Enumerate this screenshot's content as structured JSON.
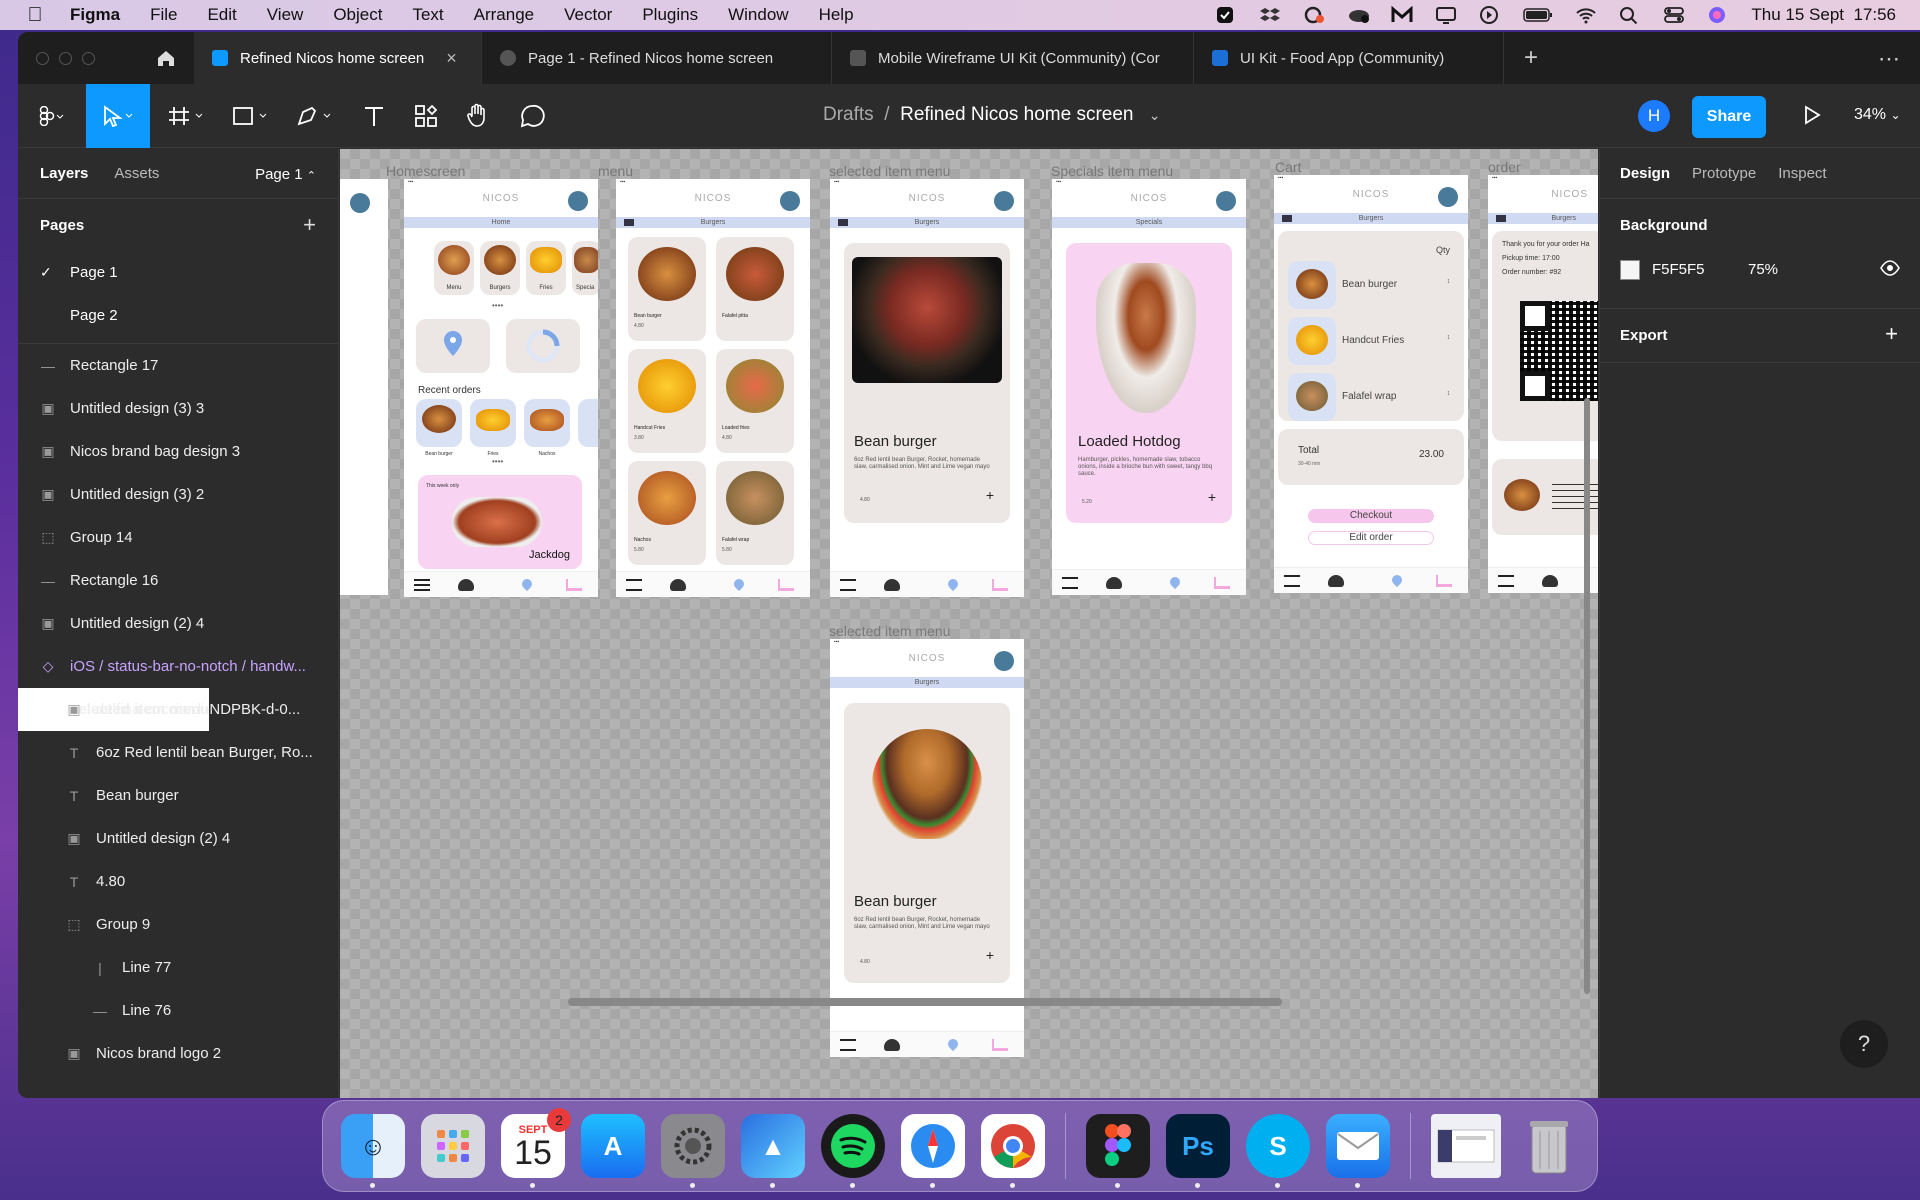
{
  "menubar": {
    "app": "Figma",
    "items": [
      "File",
      "Edit",
      "View",
      "Object",
      "Text",
      "Arrange",
      "Vector",
      "Plugins",
      "Window",
      "Help"
    ],
    "clock": "Thu 15 Sept  17:56"
  },
  "tabs": [
    {
      "label": "Refined Nicos home screen"
    },
    {
      "label": "Page 1 - Refined Nicos home screen"
    },
    {
      "label": "Mobile Wireframe UI Kit (Community) (Cor"
    },
    {
      "label": "UI Kit - Food App (Community)"
    }
  ],
  "toolbar": {
    "crumb_root": "Drafts",
    "crumb_sep": "/",
    "file_name": "Refined Nicos home screen",
    "avatar_initial": "H",
    "share_label": "Share",
    "zoom": "34%"
  },
  "left_panel": {
    "tab_layers": "Layers",
    "tab_assets": "Assets",
    "page_selector": "Page 1",
    "pages_heading": "Pages",
    "pages": [
      "Page 1",
      "Page 2"
    ],
    "layers": [
      {
        "label": "Rectangle 17",
        "kind": "rect",
        "indent": 0
      },
      {
        "label": "Untitled design (3) 3",
        "kind": "image",
        "indent": 0
      },
      {
        "label": "Nicos brand bag design 3",
        "kind": "image",
        "indent": 0
      },
      {
        "label": "Untitled design (3) 2",
        "kind": "image",
        "indent": 0
      },
      {
        "label": "Group 14",
        "kind": "group",
        "indent": 0
      },
      {
        "label": "Rectangle 16",
        "kind": "rect",
        "indent": 0
      },
      {
        "label": "Untitled design (2) 4",
        "kind": "image",
        "indent": 0
      },
      {
        "label": "iOS / status-bar-no-notch / handw...",
        "kind": "component",
        "indent": 0
      },
      {
        "label": "selected item menu",
        "kind": "frame",
        "indent": 0
      },
      {
        "label": "delfina-cocciardi-NDPBK-d-0...",
        "kind": "image",
        "indent": 1
      },
      {
        "label": "6oz Red lentil bean Burger, Ro...",
        "kind": "text",
        "indent": 1
      },
      {
        "label": "Bean burger",
        "kind": "text",
        "indent": 1
      },
      {
        "label": "Untitled design (2) 4",
        "kind": "image",
        "indent": 1
      },
      {
        "label": "4.80",
        "kind": "text",
        "indent": 1
      },
      {
        "label": "Group 9",
        "kind": "group",
        "indent": 1
      },
      {
        "label": "Line 77",
        "kind": "vline",
        "indent": 2
      },
      {
        "label": "Line 76",
        "kind": "line",
        "indent": 2
      },
      {
        "label": "Nicos brand logo 2",
        "kind": "image",
        "indent": 1
      }
    ]
  },
  "canvas": {
    "frame_labels": [
      "Homescreen",
      "menu",
      "selected item menu",
      "Specials item menu",
      "Cart",
      "order confirmation",
      "selected item menu"
    ],
    "brand": "NICOS",
    "home": {
      "nav": "Home",
      "cats": [
        "Menu",
        "Burgers",
        "Fries",
        "Specia"
      ],
      "recent_heading": "Recent orders",
      "recent": [
        "Bean burger",
        "Fries",
        "Nachos"
      ],
      "promo_tag": "This week only",
      "promo_name": "Jackdog"
    },
    "menu": {
      "nav": "Burgers",
      "items": [
        {
          "name": "Bean burger",
          "price": "4.80"
        },
        {
          "name": "Falafel pitta",
          "price": ""
        },
        {
          "name": "Handcut Fries",
          "price": "3.80"
        },
        {
          "name": "Loaded fries",
          "price": "4.80"
        },
        {
          "name": "Nachos",
          "price": "5.80"
        },
        {
          "name": "Falafel wrap",
          "price": "5.80"
        }
      ]
    },
    "selected": {
      "nav": "Burgers",
      "title": "Bean burger",
      "desc": "6oz Red lentil bean Burger, Rocket, homemade slaw, carmalised onion, Mint and Lime vegan mayo",
      "price": "4.80"
    },
    "specials": {
      "nav": "Specials",
      "title": "Loaded Hotdog",
      "desc": "Hamburger, pickles, homemade slaw, tobacco onions, inside a brioche bun with sweet, tangy bbq sauce.",
      "price": "5.20"
    },
    "cart": {
      "nav": "Burgers",
      "qty_heading": "Qty",
      "items": [
        {
          "name": "Bean burger",
          "qty": "1"
        },
        {
          "name": "Handcut Fries",
          "qty": "1"
        },
        {
          "name": "Falafel wrap",
          "qty": "1"
        }
      ],
      "total_label": "Total",
      "total_sub": "30-40 min",
      "total_value": "23.00",
      "checkout": "Checkout",
      "edit": "Edit order"
    },
    "confirm": {
      "nav": "Burgers",
      "line1": "Thank you for your order Ha",
      "line2": "Pickup time: 17:00",
      "line3": "Order number: #92"
    }
  },
  "right_panel": {
    "tabs": [
      "Design",
      "Prototype",
      "Inspect"
    ],
    "background_heading": "Background",
    "bg_hex": "F5F5F5",
    "bg_opacity": "75%",
    "export_heading": "Export",
    "help": "?"
  },
  "dock": {
    "calendar_month": "SEPT",
    "calendar_day": "15",
    "calendar_badge": "2",
    "apps": [
      "finder-icon",
      "launchpad-icon",
      "calendar-icon",
      "app-store-icon",
      "system-settings-icon",
      "affinity-icon",
      "spotify-icon",
      "safari-icon",
      "chrome-icon",
      "figma-icon",
      "photoshop-icon",
      "skype-icon",
      "mail-icon",
      "preview-window-icon",
      "trash-icon"
    ]
  },
  "colors": {
    "accent": "#0d99ff",
    "canvas_bg": "#f5f5f5",
    "nav_band": "#cfd9f2",
    "pink": "#f9d4f2"
  }
}
